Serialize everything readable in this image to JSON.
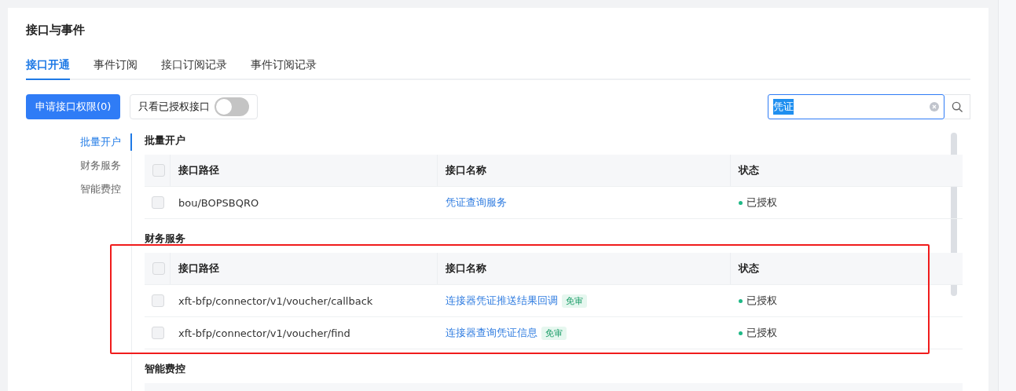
{
  "page": {
    "title": "接口与事件"
  },
  "tabs": [
    {
      "label": "接口开通",
      "selected": true
    },
    {
      "label": "事件订阅",
      "selected": false
    },
    {
      "label": "接口订阅记录",
      "selected": false
    },
    {
      "label": "事件订阅记录",
      "selected": false
    }
  ],
  "toolbar": {
    "apply_button": "申请接口权限(0)",
    "authorized_only": {
      "label": "只看已授权接口",
      "on": false
    },
    "search": {
      "value": "凭证",
      "text_selected": true
    }
  },
  "nav": [
    {
      "label": "批量开户",
      "selected": true
    },
    {
      "label": "财务服务",
      "selected": false
    },
    {
      "label": "智能费控",
      "selected": false
    }
  ],
  "sections": [
    {
      "title": "批量开户",
      "highlighted": false,
      "header_checked": false,
      "columns": [
        "接口路径",
        "接口名称",
        "状态"
      ],
      "rows": [
        {
          "path": "bou/BOPSBQRO",
          "name": "凭证查询服务",
          "tag": null,
          "status": "已授权",
          "color": "#1fb886",
          "checked": false
        }
      ]
    },
    {
      "title": "财务服务",
      "highlighted": true,
      "header_checked": false,
      "columns": [
        "接口路径",
        "接口名称",
        "状态"
      ],
      "rows": [
        {
          "path": "xft-bfp/connector/v1/voucher/callback",
          "name": "连接器凭证推送结果回调",
          "tag": "免审",
          "status": "已授权",
          "color": "#1fb886",
          "checked": false
        },
        {
          "path": "xft-bfp/connector/v1/voucher/find",
          "name": "连接器查询凭证信息",
          "tag": "免审",
          "status": "已授权",
          "color": "#1fb886",
          "checked": false
        }
      ]
    },
    {
      "title": "智能费控",
      "highlighted": false
    }
  ]
}
